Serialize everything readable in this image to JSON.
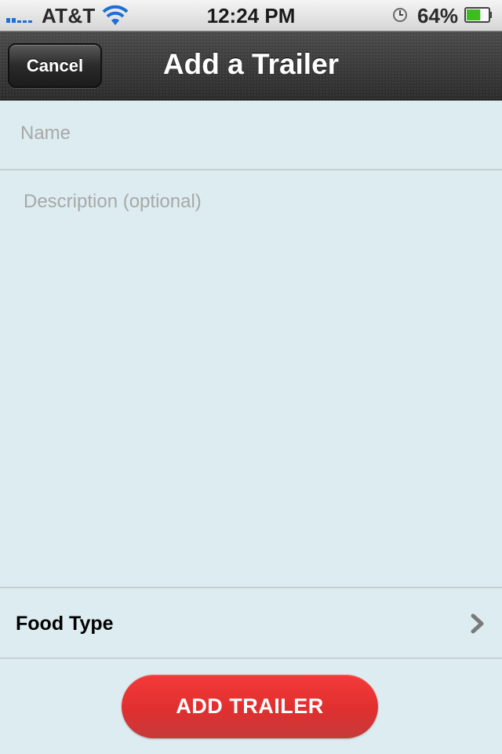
{
  "status_bar": {
    "carrier": "AT&T",
    "time": "12:24 PM",
    "battery_percent": "64%",
    "battery_level": 0.64,
    "signal_bars": 2,
    "icons": [
      "signal-icon",
      "wifi-icon",
      "clock-icon",
      "battery-icon"
    ]
  },
  "nav_bar": {
    "cancel_label": "Cancel",
    "title": "Add a Trailer"
  },
  "form": {
    "name": {
      "placeholder": "Name",
      "value": ""
    },
    "description": {
      "placeholder": "Description (optional)",
      "value": ""
    },
    "food_type": {
      "label": "Food Type",
      "icon": "chevron-right-icon"
    }
  },
  "actions": {
    "add_label": "ADD TRAILER"
  },
  "colors": {
    "background": "#dcecf0",
    "nav_bar": "#333333",
    "accent_button": "#e02f2f",
    "separator": "#c6d0d3"
  }
}
